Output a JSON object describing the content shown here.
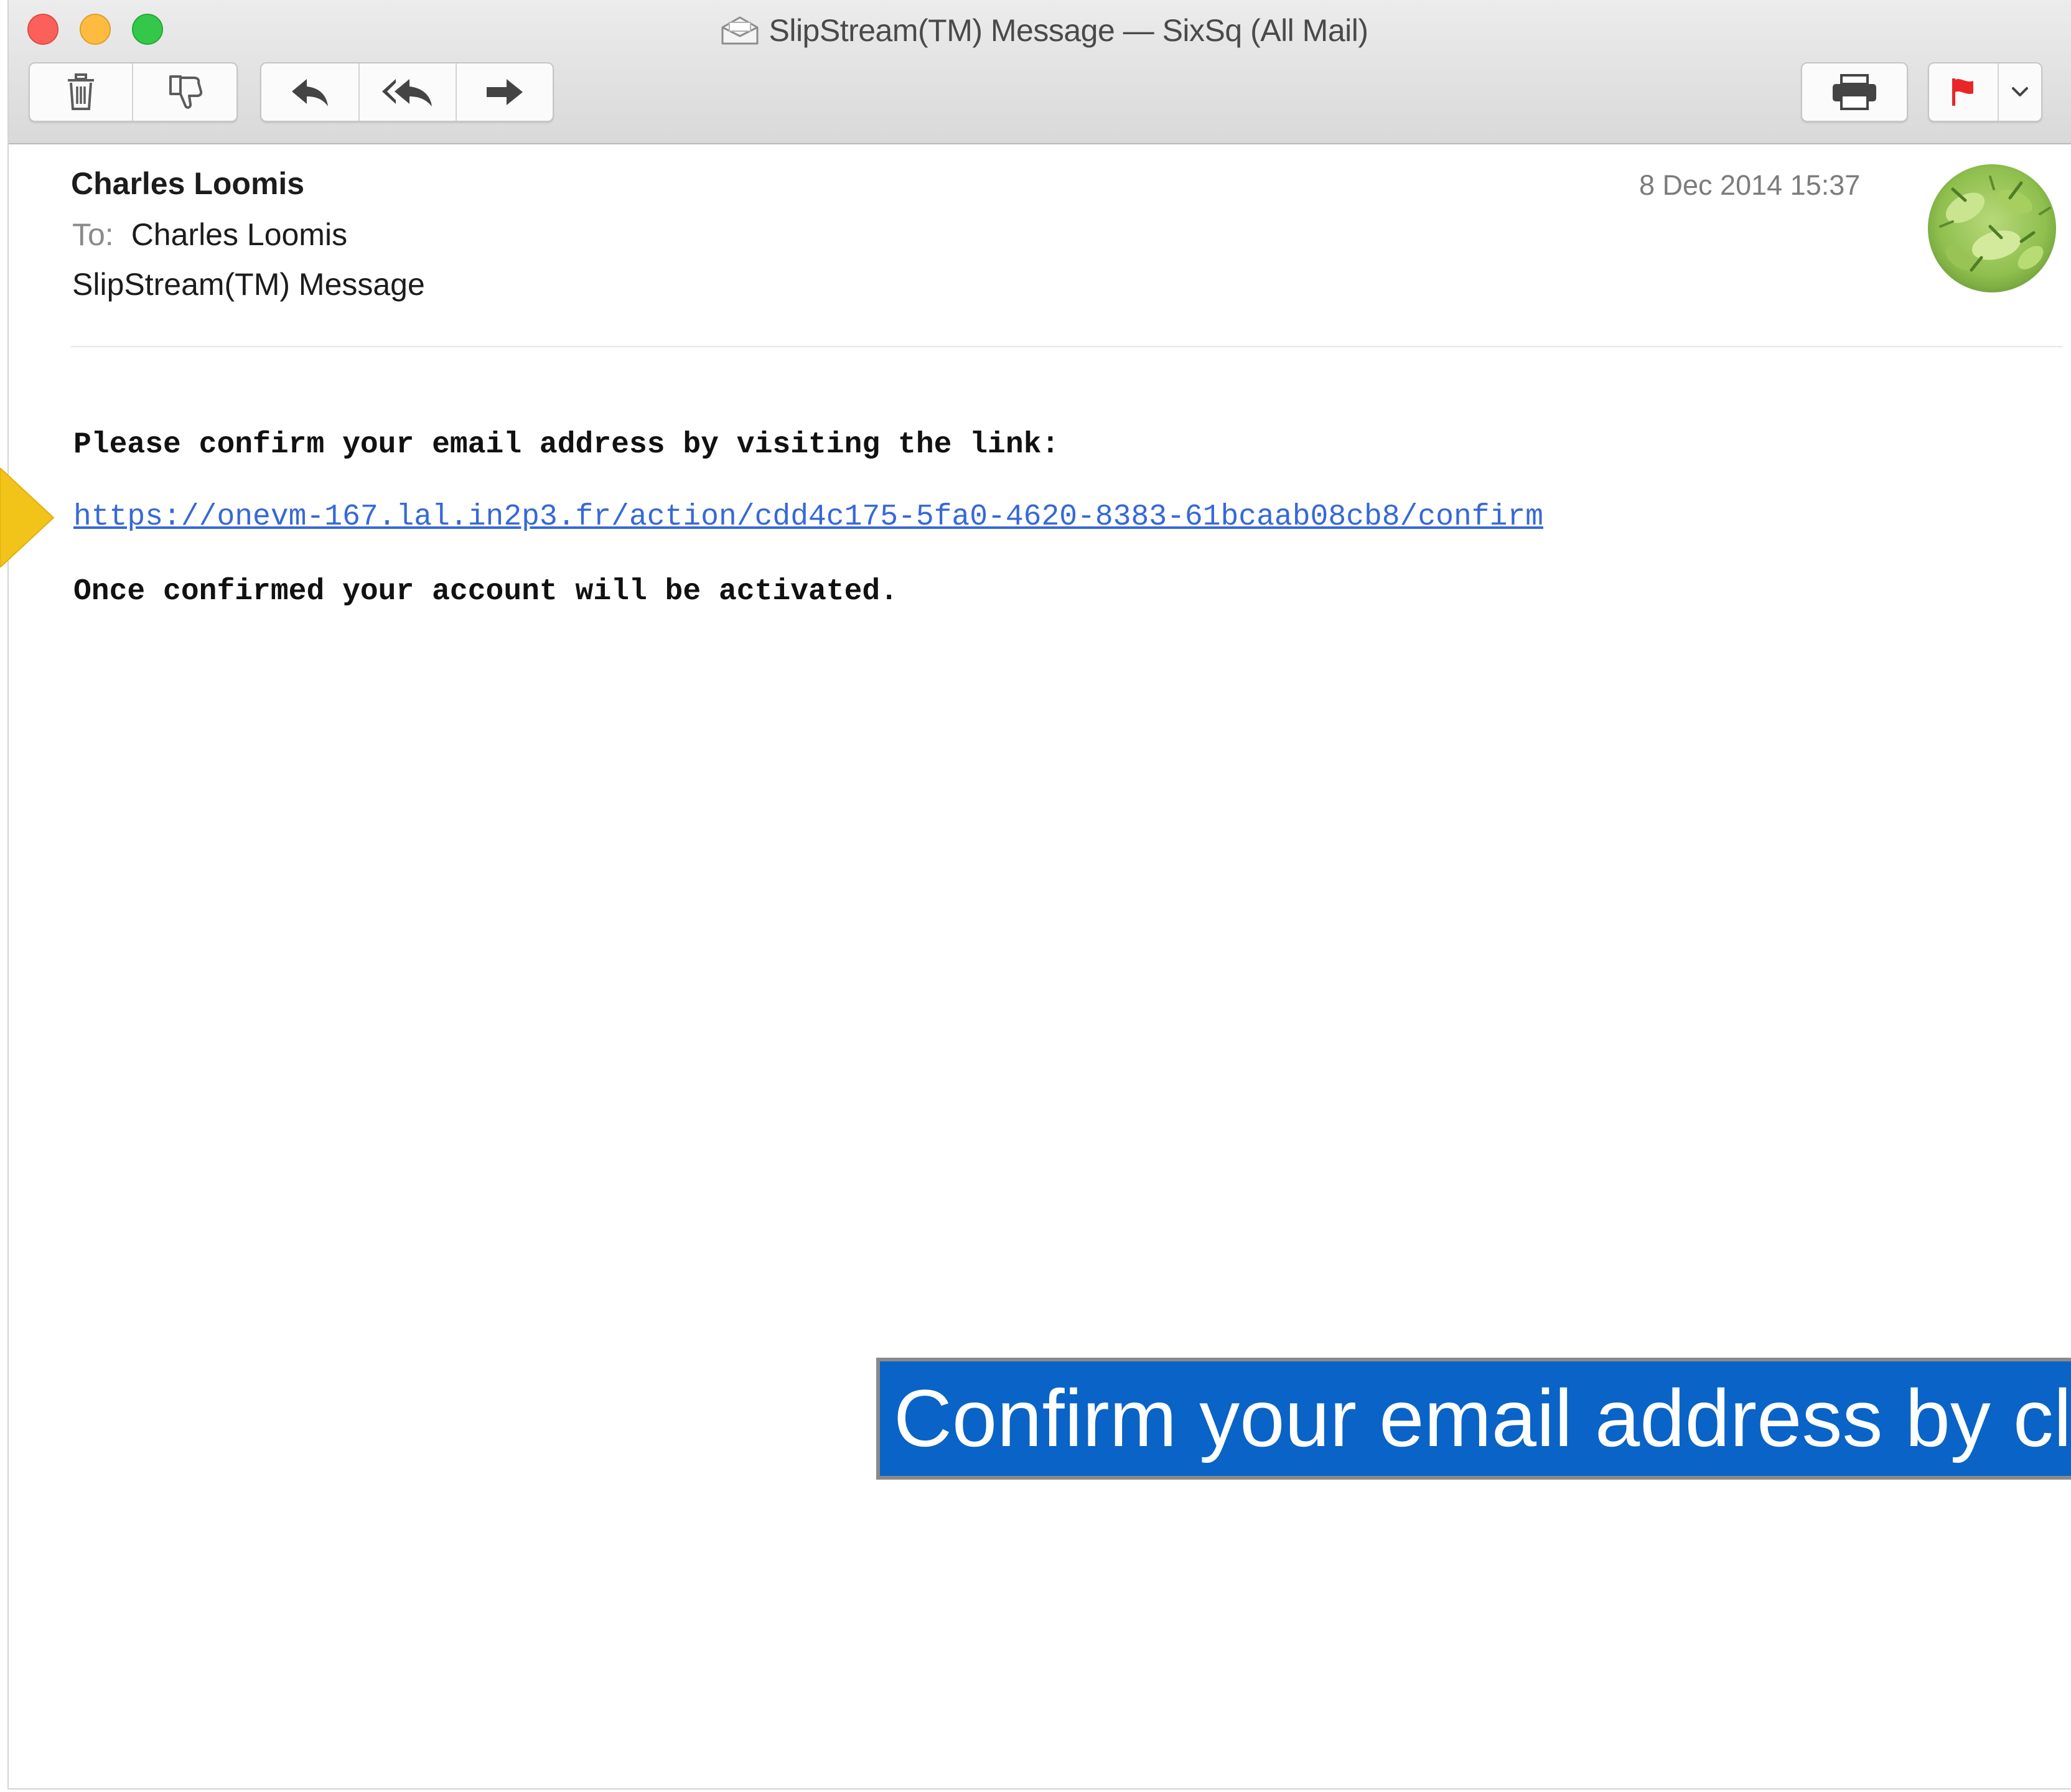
{
  "window": {
    "title": "SlipStream(TM) Message — SixSq (All Mail)"
  },
  "toolbar": {
    "groups": [
      {
        "name": "delete-junk",
        "buttons": [
          "trash-icon",
          "junk-thumb-down-icon"
        ]
      },
      {
        "name": "reply-actions",
        "buttons": [
          "reply-icon",
          "reply-all-icon",
          "forward-icon"
        ]
      },
      {
        "name": "print",
        "buttons": [
          "printer-icon"
        ]
      },
      {
        "name": "flag",
        "buttons": [
          "flag-icon",
          "chevron-down-icon"
        ]
      }
    ],
    "flag_color": "#e8262a"
  },
  "message": {
    "sender": "Charles Loomis",
    "to_label": "To:",
    "to_value": "Charles Loomis",
    "subject": "SlipStream(TM) Message",
    "date": "8 Dec 2014 15:37",
    "avatar": "contact-photo",
    "body": {
      "line1": "Please confirm your email address by visiting the link:",
      "link": "https://onevm-167.lal.in2p3.fr/action/cdd4c175-5fa0-4620-8383-61bcaab08cb8/confirm",
      "line2": "Once confirmed your account will be activated."
    }
  },
  "annotation": {
    "caption": "Confirm your email address by cli",
    "caption_bg": "#0a63c6",
    "arrow_color": "#f2c318"
  },
  "colors": {
    "link": "#3668d8",
    "traffic_close": "#fc605b",
    "traffic_min": "#fdbc40",
    "traffic_max": "#34c84a"
  }
}
